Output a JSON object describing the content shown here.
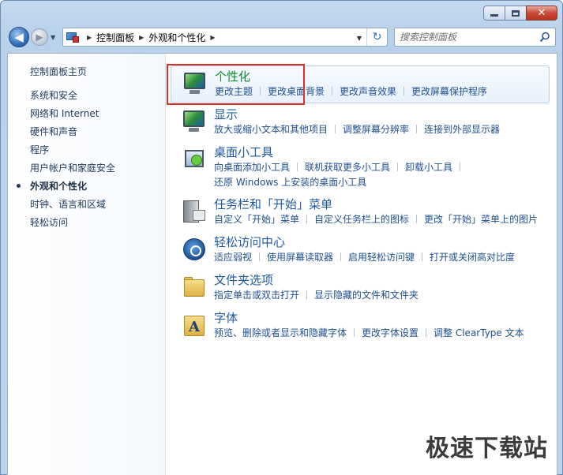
{
  "window": {
    "minimize_label": "",
    "maximize_label": "",
    "close_label": "✕"
  },
  "nav": {
    "back": "◀",
    "forward": "▶",
    "breadcrumbs": [
      "控制面板",
      "外观和个性化"
    ],
    "refresh": "↻",
    "search_placeholder": "搜索控制面板"
  },
  "sidebar": {
    "home": "控制面板主页",
    "items": [
      {
        "label": "系统和安全",
        "active": false
      },
      {
        "label": "网络和 Internet",
        "active": false
      },
      {
        "label": "硬件和声音",
        "active": false
      },
      {
        "label": "程序",
        "active": false
      },
      {
        "label": "用户帐户和家庭安全",
        "active": false
      },
      {
        "label": "外观和个性化",
        "active": true
      },
      {
        "label": "时钟、语言和区域",
        "active": false
      },
      {
        "label": "轻松访问",
        "active": false
      }
    ]
  },
  "categories": [
    {
      "title": "个性化",
      "icon": "personalization-icon",
      "highlight": true,
      "links": [
        "更改主题",
        "更改桌面背景",
        "更改声音效果",
        "更改屏幕保护程序"
      ]
    },
    {
      "title": "显示",
      "icon": "display-icon",
      "links": [
        "放大或缩小文本和其他项目",
        "调整屏幕分辨率",
        "连接到外部显示器"
      ]
    },
    {
      "title": "桌面小工具",
      "icon": "gadgets-icon",
      "links": [
        "向桌面添加小工具",
        "联机获取更多小工具",
        "卸载小工具"
      ],
      "links2": [
        "还原 Windows 上安装的桌面小工具"
      ]
    },
    {
      "title": "任务栏和「开始」菜单",
      "icon": "taskbar-icon",
      "links": [
        "自定义「开始」菜单",
        "自定义任务栏上的图标",
        "更改「开始」菜单上的图片"
      ]
    },
    {
      "title": "轻松访问中心",
      "icon": "ease-of-access-icon",
      "links": [
        "适应弱视",
        "使用屏幕读取器",
        "启用轻松访问键",
        "打开或关闭高对比度"
      ]
    },
    {
      "title": "文件夹选项",
      "icon": "folder-options-icon",
      "links": [
        "指定单击或双击打开",
        "显示隐藏的文件和文件夹"
      ]
    },
    {
      "title": "字体",
      "icon": "fonts-icon",
      "links": [
        "预览、删除或者显示和隐藏字体",
        "更改字体设置",
        "调整 ClearType 文本"
      ]
    }
  ],
  "watermark": "极速下载站",
  "colors": {
    "link": "#1e4f8f",
    "highlight_title": "#0f8a2e",
    "annotation_box": "#d9302a"
  }
}
